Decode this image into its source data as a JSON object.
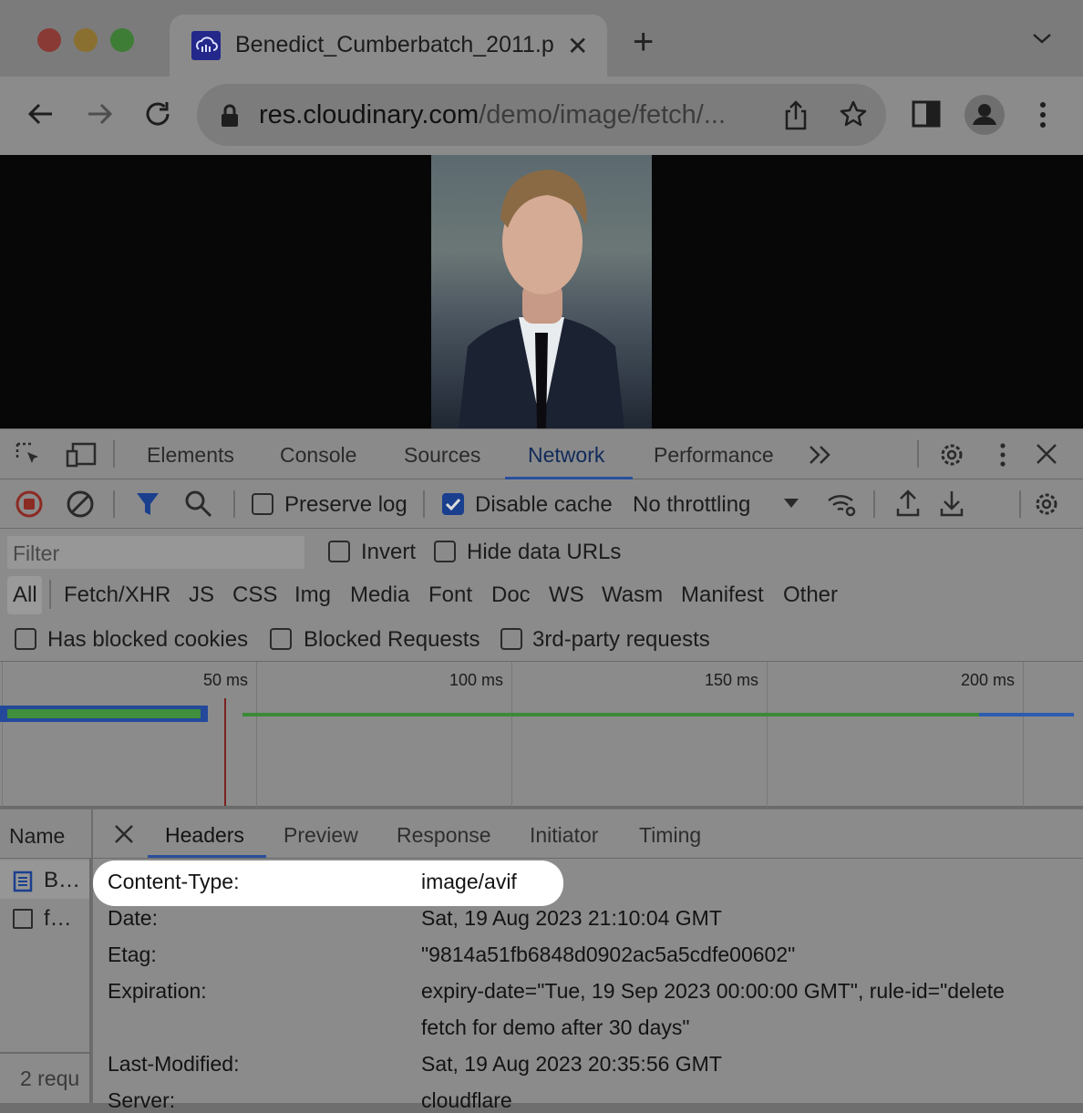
{
  "browser": {
    "tab_title": "Benedict_Cumberbatch_2011.p",
    "url_host": "res.cloudinary.com",
    "url_path": "/demo/image/fetch/..."
  },
  "devtools": {
    "tabs": [
      "Elements",
      "Console",
      "Sources",
      "Network",
      "Performance"
    ],
    "toolbar": {
      "preserve_log": "Preserve log",
      "disable_cache": "Disable cache",
      "throttling": "No throttling"
    },
    "filter": {
      "placeholder": "Filter",
      "invert": "Invert",
      "hide_data_urls": "Hide data URLs"
    },
    "types": [
      "All",
      "Fetch/XHR",
      "JS",
      "CSS",
      "Img",
      "Media",
      "Font",
      "Doc",
      "WS",
      "Wasm",
      "Manifest",
      "Other"
    ],
    "options": {
      "has_blocked_cookies": "Has blocked cookies",
      "blocked_requests": "Blocked Requests",
      "third_party": "3rd-party requests"
    },
    "timeline_ticks": [
      "50 ms",
      "100 ms",
      "150 ms",
      "200 ms"
    ],
    "name_column": {
      "header": "Name",
      "rows": [
        "B…",
        "f…"
      ],
      "footer": "2 requ"
    },
    "detail_tabs": [
      "Headers",
      "Preview",
      "Response",
      "Initiator",
      "Timing"
    ],
    "headers": [
      {
        "key": "Content-Type:",
        "value": "image/avif"
      },
      {
        "key": "Date:",
        "value": "Sat, 19 Aug 2023 21:10:04 GMT"
      },
      {
        "key": "Etag:",
        "value": "\"9814a51fb6848d0902ac5a5cdfe00602\""
      },
      {
        "key": "Expiration:",
        "value": "expiry-date=\"Tue, 19 Sep 2023 00:00:00 GMT\", rule-id=\"delete",
        "value_cont": "fetch for demo after 30 days\""
      },
      {
        "key": "Last-Modified:",
        "value": "Sat, 19 Aug 2023 20:35:56 GMT"
      },
      {
        "key": "Server:",
        "value": "cloudflare"
      }
    ]
  }
}
